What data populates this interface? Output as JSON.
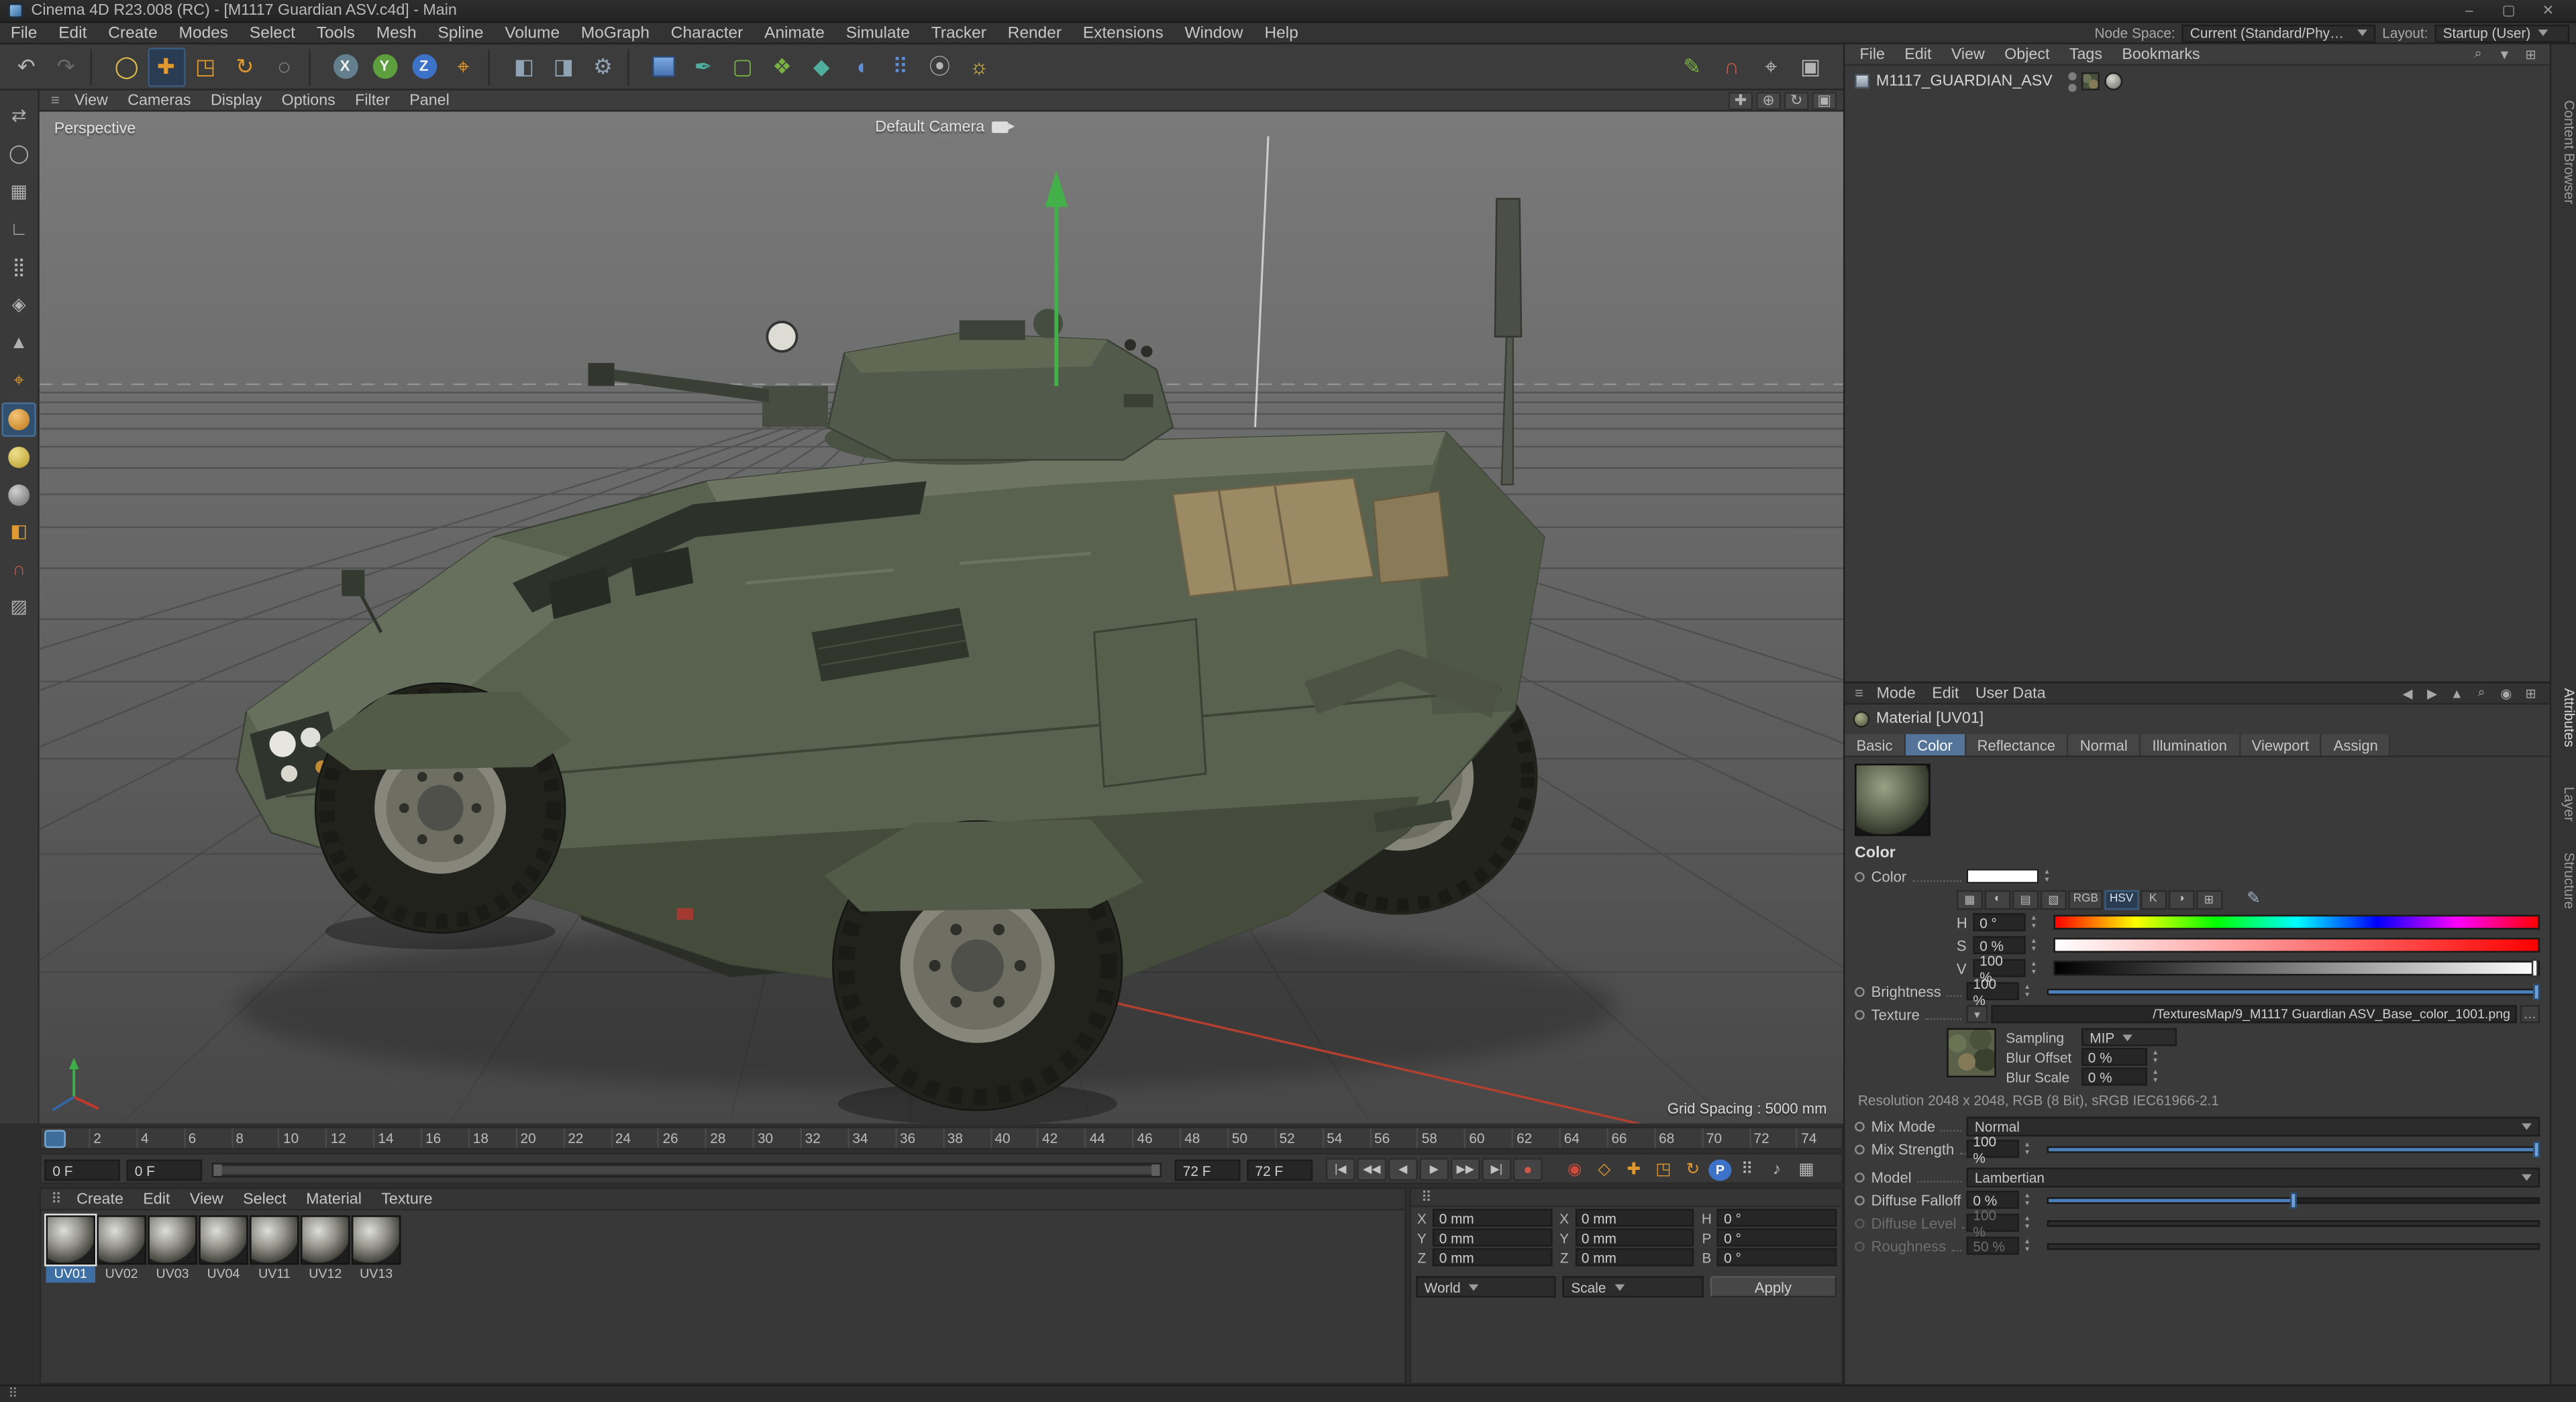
{
  "window": {
    "title": "Cinema 4D R23.008 (RC) - [M1117 Guardian ASV.c4d] - Main",
    "minimize_glyph": "–",
    "maximize_glyph": "▢",
    "close_glyph": "✕"
  },
  "glyphs": {
    "hamburger": "≡",
    "handle": "⠿",
    "more": "…",
    "eyedropper": "✎"
  },
  "colors": {
    "accent_blue": "#4c80bd",
    "tool_orange": "#e0982f",
    "axis_green": "#5d9e3f",
    "axis_blue": "#3c73c8",
    "hull_olive": "#59614f"
  },
  "menubar": {
    "items": [
      "File",
      "Edit",
      "Create",
      "Modes",
      "Select",
      "Tools",
      "Mesh",
      "Spline",
      "Volume",
      "MoGraph",
      "Character",
      "Animate",
      "Simulate",
      "Tracker",
      "Render",
      "Extensions",
      "Window",
      "Help"
    ],
    "node_space_label": "Node Space:",
    "node_space_value": "Current (Standard/Physical)",
    "layout_label": "Layout:",
    "layout_value": "Startup (User)"
  },
  "toolbar": {
    "icons": [
      {
        "name": "undo-icon",
        "glyph": "↶",
        "cls": "g"
      },
      {
        "name": "redo-icon",
        "glyph": "↷",
        "cls": "dim"
      },
      {
        "name": "separator",
        "glyph": "",
        "cls": "sep"
      },
      {
        "name": "live-selection-tool",
        "glyph": "◯",
        "cls": "yellow"
      },
      {
        "name": "move-tool",
        "glyph": "✚",
        "cls": "orange act"
      },
      {
        "name": "scale-tool",
        "glyph": "◳",
        "cls": "orange"
      },
      {
        "name": "rotate-tool",
        "glyph": "↻",
        "cls": "orange"
      },
      {
        "name": "last-tool-icon",
        "glyph": "◌",
        "cls": "g"
      },
      {
        "name": "separator",
        "glyph": "",
        "cls": "sep"
      },
      {
        "name": "x-axis-lock",
        "glyph": "X",
        "cls": "ax ax-x"
      },
      {
        "name": "y-axis-lock",
        "glyph": "Y",
        "cls": "ax ax-y"
      },
      {
        "name": "z-axis-lock",
        "glyph": "Z",
        "cls": "ax ax-z"
      },
      {
        "name": "coord-system-toggle",
        "glyph": "⌖",
        "cls": "orange"
      },
      {
        "name": "separator",
        "glyph": "",
        "cls": "sep"
      },
      {
        "name": "render-view-button",
        "glyph": "◧",
        "cls": "slate"
      },
      {
        "name": "render-picture-viewer-button",
        "glyph": "◨",
        "cls": "slate"
      },
      {
        "name": "render-settings-button",
        "glyph": "⚙",
        "cls": "slate"
      },
      {
        "name": "separator",
        "glyph": "",
        "cls": "sep"
      },
      {
        "name": "add-primitive-button",
        "glyph": "",
        "cls": "cube"
      },
      {
        "name": "add-spline-button",
        "glyph": "✒",
        "cls": "teal"
      },
      {
        "name": "add-subdivision-button",
        "glyph": "▢",
        "cls": "green"
      },
      {
        "name": "add-modeling-button",
        "glyph": "❖",
        "cls": "green"
      },
      {
        "name": "add-volume-button",
        "glyph": "◆",
        "cls": "teal"
      },
      {
        "name": "add-deformer-button",
        "glyph": "◖",
        "cls": "blue"
      },
      {
        "name": "add-mograph-button",
        "glyph": "⠿",
        "cls": "blue"
      },
      {
        "name": "add-simulate-button",
        "glyph": "⦿",
        "cls": "g"
      },
      {
        "name": "add-light-button",
        "glyph": "☼",
        "cls": "yellow"
      }
    ],
    "right_icons": [
      {
        "name": "sketch-tool-icon",
        "glyph": "✎",
        "cls": "green"
      },
      {
        "name": "snap-settings-icon",
        "glyph": "∩",
        "cls": "red"
      },
      {
        "name": "axis-settings-icon",
        "glyph": "⌖",
        "cls": "g"
      },
      {
        "name": "viewport-settings-icon",
        "glyph": "▣",
        "cls": "g"
      }
    ]
  },
  "left_palette": {
    "icons": [
      {
        "name": "make-editable-button",
        "glyph": "⇄",
        "cls": "g"
      },
      {
        "name": "model-mode-button",
        "glyph": "◯",
        "cls": "g"
      },
      {
        "name": "texture-mode-button",
        "glyph": "▦",
        "cls": "g"
      },
      {
        "name": "workplane-mode-button",
        "glyph": "∟",
        "cls": "g"
      },
      {
        "name": "points-mode-button",
        "glyph": "⣿",
        "cls": "g"
      },
      {
        "name": "edges-mode-button",
        "glyph": "◈",
        "cls": "g"
      },
      {
        "name": "polygons-mode-button",
        "glyph": "▲",
        "cls": "g"
      },
      {
        "name": "enable-axis-button",
        "glyph": "⌖",
        "cls": "orange"
      },
      {
        "name": "object-axis-mode-button",
        "glyph": "",
        "cls": "ball-orange act"
      },
      {
        "name": "texture-axis-mode-button",
        "glyph": "",
        "cls": "ball-yellow"
      },
      {
        "name": "normal-mode-button",
        "glyph": "",
        "cls": "ball-gray"
      },
      {
        "name": "paint-mode-button",
        "glyph": "◧",
        "cls": "orange"
      },
      {
        "name": "snap-toggle-button",
        "glyph": "∩",
        "cls": "red"
      },
      {
        "name": "xray-toggle-button",
        "glyph": "▨",
        "cls": "g"
      }
    ]
  },
  "viewport": {
    "menus": [
      "View",
      "Cameras",
      "Display",
      "Options",
      "Filter",
      "Panel"
    ],
    "nav_icons": [
      {
        "name": "pan-view-icon",
        "glyph": "✚"
      },
      {
        "name": "zoom-view-icon",
        "glyph": "⊕"
      },
      {
        "name": "rotate-view-icon",
        "glyph": "↻"
      },
      {
        "name": "toggle-panels-icon",
        "glyph": "▣"
      }
    ],
    "view_label": "Perspective",
    "camera_label": "Default Camera",
    "grid_spacing": "Grid Spacing : 5000 mm"
  },
  "object_manager": {
    "menus": [
      "File",
      "Edit",
      "View",
      "Object",
      "Tags",
      "Bookmarks"
    ],
    "header_icons": [
      {
        "name": "search-icon",
        "glyph": "⌕"
      },
      {
        "name": "filter-icon",
        "glyph": "▼"
      },
      {
        "name": "panel-icon",
        "glyph": "⊞"
      }
    ],
    "object_name": "M1117_GUARDIAN_ASV"
  },
  "timeline": {
    "frames": [
      "0",
      "2",
      "4",
      "6",
      "8",
      "10",
      "12",
      "14",
      "16",
      "18",
      "20",
      "22",
      "24",
      "26",
      "28",
      "30",
      "32",
      "34",
      "36",
      "38",
      "40",
      "42",
      "44",
      "46",
      "48",
      "50",
      "52",
      "54",
      "56",
      "58",
      "60",
      "62",
      "64",
      "66",
      "68",
      "70",
      "72",
      "74"
    ],
    "current": "0 F",
    "start": "0 F",
    "end": "72 F",
    "end2": "72 F",
    "transport": [
      {
        "name": "goto-start-button",
        "glyph": "|◀",
        "cls": "g"
      },
      {
        "name": "prev-key-button",
        "glyph": "◀◀",
        "cls": "g"
      },
      {
        "name": "prev-frame-button",
        "glyph": "◀",
        "cls": "g"
      },
      {
        "name": "play-button",
        "glyph": "▶",
        "cls": "g"
      },
      {
        "name": "next-frame-button",
        "glyph": "▶▶",
        "cls": "g"
      },
      {
        "name": "next-key-button",
        "glyph": "▶|",
        "cls": "g"
      },
      {
        "name": "record-button",
        "glyph": "●",
        "cls": "rec"
      }
    ],
    "key_icons": [
      {
        "name": "autokey-toggle",
        "glyph": "◉",
        "cls": "red"
      },
      {
        "name": "keyframe-selection-toggle",
        "glyph": "◇",
        "cls": "orange"
      },
      {
        "name": "key-position-toggle",
        "glyph": "✚",
        "cls": "orange"
      },
      {
        "name": "key-scale-toggle",
        "glyph": "◳",
        "cls": "orange"
      },
      {
        "name": "key-rotation-toggle",
        "glyph": "↻",
        "cls": "orange"
      },
      {
        "name": "key-parameter-toggle",
        "glyph": "P",
        "cls": "pblue"
      },
      {
        "name": "key-pla-toggle",
        "glyph": "⠿",
        "cls": "g"
      },
      {
        "name": "sound-toggle",
        "glyph": "♪",
        "cls": "g"
      },
      {
        "name": "playback-settings-icon",
        "glyph": "▦",
        "cls": "g"
      }
    ]
  },
  "materials": {
    "menus": [
      "Create",
      "Edit",
      "View",
      "Select",
      "Material",
      "Texture"
    ],
    "items": [
      {
        "label": "UV01",
        "sel": true
      },
      {
        "label": "UV02"
      },
      {
        "label": "UV03"
      },
      {
        "label": "UV04"
      },
      {
        "label": "UV11"
      },
      {
        "label": "UV12"
      },
      {
        "label": "UV13"
      }
    ]
  },
  "coordinates": {
    "rows": [
      {
        "a1": "X",
        "v1": "0 mm",
        "a2": "X",
        "v2": "0 mm",
        "a3": "H",
        "v3": "0 °"
      },
      {
        "a1": "Y",
        "v1": "0 mm",
        "a2": "Y",
        "v2": "0 mm",
        "a3": "P",
        "v3": "0 °"
      },
      {
        "a1": "Z",
        "v1": "0 mm",
        "a2": "Z",
        "v2": "0 mm",
        "a3": "B",
        "v3": "0 °"
      }
    ],
    "world": "World",
    "scale": "Scale",
    "apply": "Apply"
  },
  "attributes": {
    "menus": [
      "Mode",
      "Edit",
      "User Data"
    ],
    "header_icons": [
      {
        "name": "back-icon",
        "glyph": "◀"
      },
      {
        "name": "forward-icon",
        "glyph": "▶"
      },
      {
        "name": "up-icon",
        "glyph": "▲"
      },
      {
        "name": "search-icon",
        "glyph": "⌕"
      },
      {
        "name": "lock-icon",
        "glyph": "◉"
      },
      {
        "name": "panel-icon",
        "glyph": "⊞"
      }
    ],
    "material_title": "Material [UV01]",
    "tabs": [
      {
        "label": "Basic"
      },
      {
        "label": "Color",
        "active": true
      },
      {
        "label": "Reflectance"
      },
      {
        "label": "Normal"
      },
      {
        "label": "Illumination"
      },
      {
        "label": "Viewport"
      },
      {
        "label": "Assign"
      }
    ],
    "section_label": "Color",
    "color_label": "Color",
    "picker_icons": [
      {
        "name": "swatch-mode-button",
        "glyph": "▦"
      },
      {
        "name": "wheel-mode-button",
        "glyph": "◐"
      },
      {
        "name": "spectrum-mode-button",
        "glyph": "▤"
      },
      {
        "name": "picture-mode-button",
        "glyph": "▧"
      },
      {
        "name": "rgb-mode-button",
        "glyph": "RGB"
      },
      {
        "name": "hsv-mode-button",
        "glyph": "HSV",
        "active": true
      },
      {
        "name": "kelvin-mode-button",
        "glyph": "K"
      },
      {
        "name": "mixing-mode-button",
        "glyph": "◑"
      },
      {
        "name": "swatches-button",
        "glyph": "⊞"
      }
    ],
    "hsv": [
      {
        "l": "H",
        "v": "0 °",
        "bar": "hue"
      },
      {
        "l": "S",
        "v": "0 %",
        "bar": "sat"
      },
      {
        "l": "V",
        "v": "100 %",
        "bar": "val"
      }
    ],
    "brightness_label": "Brightness",
    "brightness_value": "100 %",
    "texture_label": "Texture",
    "texture_path": "/TexturesMap/9_M1117 Guardian ASV_Base_color_1001.png",
    "sampling_label": "Sampling",
    "sampling_value": "MIP",
    "blur_offset_label": "Blur Offset",
    "blur_offset_value": "0 %",
    "blur_scale_label": "Blur Scale",
    "blur_scale_value": "0 %",
    "resolution": "Resolution 2048 x 2048, RGB (8 Bit), sRGB IEC61966-2.1",
    "mix_mode_label": "Mix Mode",
    "mix_mode_value": "Normal",
    "mix_strength_label": "Mix Strength",
    "mix_strength_value": "100 %",
    "model_label": "Model",
    "model_value": "Lambertian",
    "diffuse_falloff_label": "Diffuse Falloff",
    "diffuse_falloff_value": "0 %",
    "diffuse_level_label": "Diffuse Level",
    "diffuse_level_value": "100 %",
    "roughness_label": "Roughness",
    "roughness_value": "50 %"
  },
  "side_tabs": [
    "Content Browser",
    "Attributes",
    "Layer",
    "Structure"
  ]
}
